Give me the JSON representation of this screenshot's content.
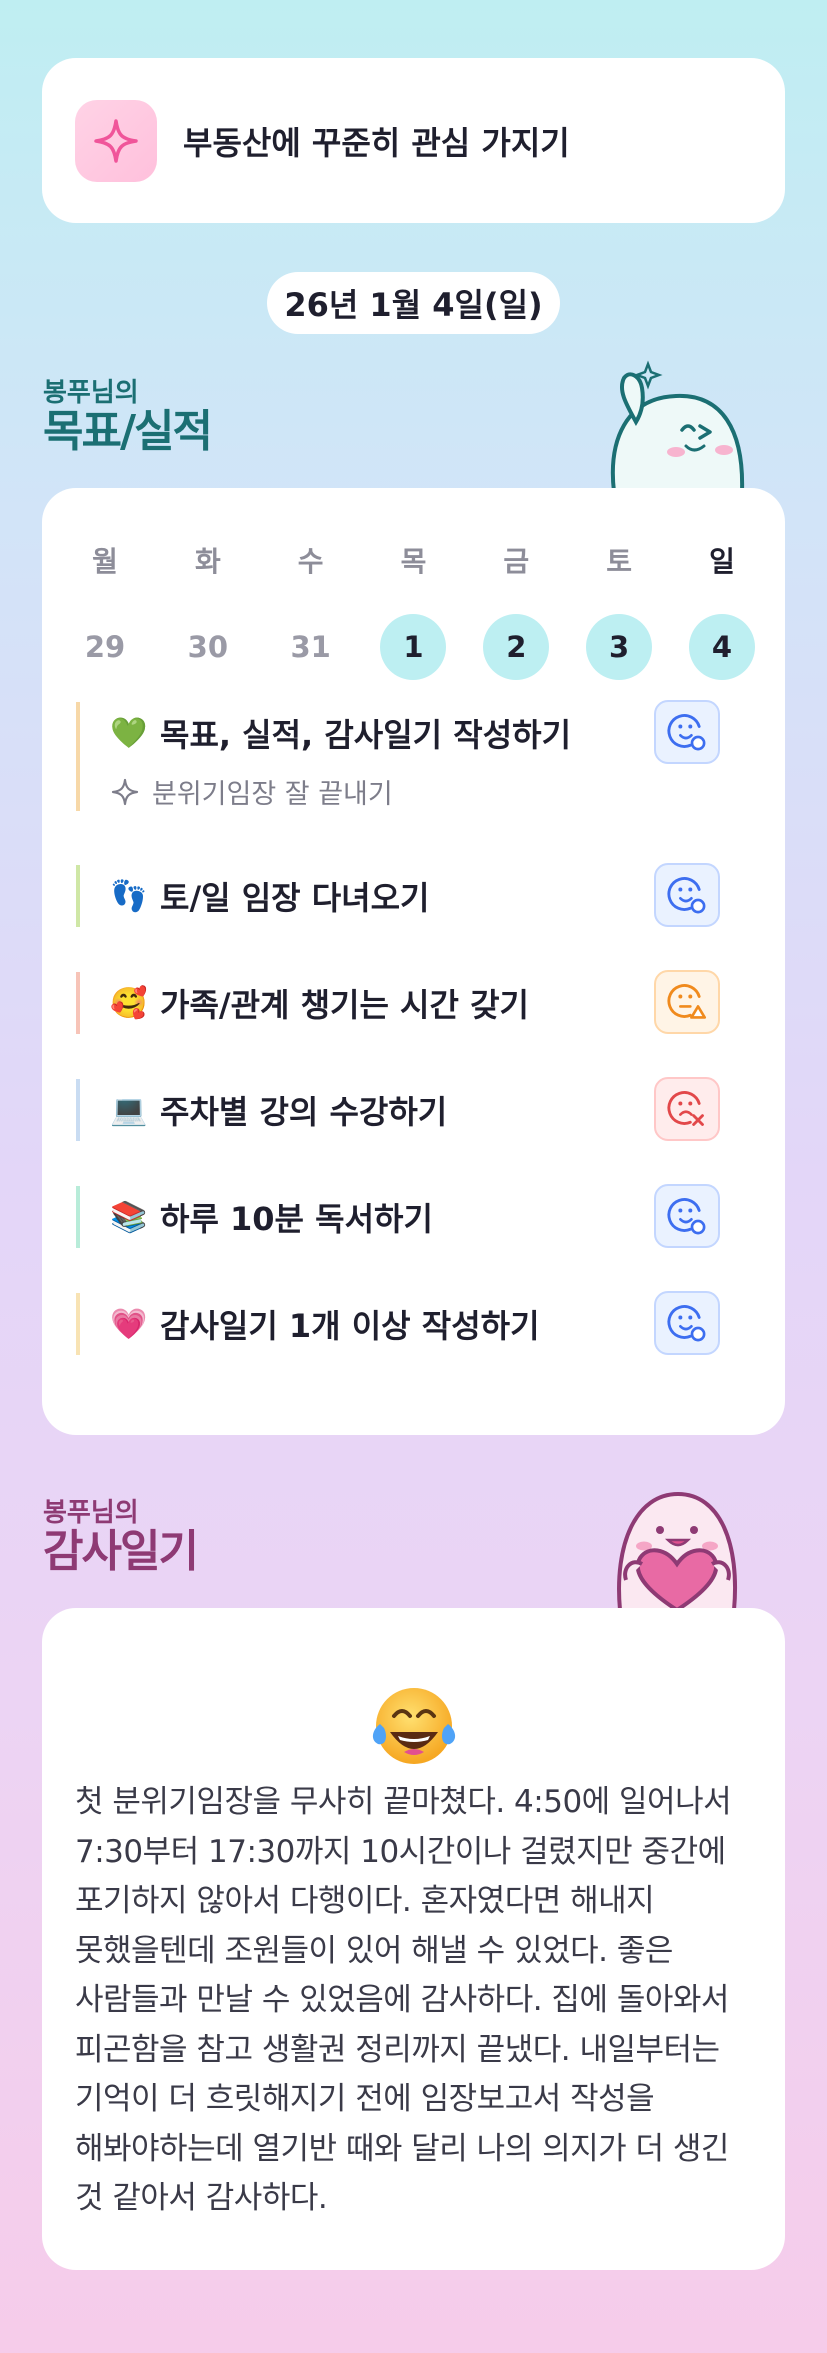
{
  "goal_banner": {
    "text": "부동산에 꾸준히 관심 가지기",
    "icon": "sparkle-icon"
  },
  "date": "26년 1월 4일(일)",
  "goals_section": {
    "owner": "봉푸님의",
    "title": "목표/실적"
  },
  "week": {
    "days": [
      {
        "dow": "월",
        "date": "29",
        "highlighted": false
      },
      {
        "dow": "화",
        "date": "30",
        "highlighted": false
      },
      {
        "dow": "수",
        "date": "31",
        "highlighted": false
      },
      {
        "dow": "목",
        "date": "1",
        "highlighted": true
      },
      {
        "dow": "금",
        "date": "2",
        "highlighted": true
      },
      {
        "dow": "토",
        "date": "3",
        "highlighted": true
      },
      {
        "dow": "일",
        "date": "4",
        "highlighted": true
      }
    ]
  },
  "tasks": [
    {
      "emoji": "💚",
      "label": "목표, 실적, 감사일기 작성하기",
      "sub": "분위기임장 잘 끝내기",
      "status": "done",
      "color": "#f7d8a8"
    },
    {
      "emoji": "👣",
      "label": "토/일 임장 다녀오기",
      "status": "done",
      "color": "#cfe7a6"
    },
    {
      "emoji": "🥰",
      "label": "가족/관계 챙기는 시간 갖기",
      "status": "partial",
      "color": "#f7c4b8"
    },
    {
      "emoji": "💻",
      "label": "주차별 강의 수강하기",
      "status": "failed",
      "color": "#c9dcf2"
    },
    {
      "emoji": "📚",
      "label": "하루 10분 독서하기",
      "status": "done",
      "color": "#b8ecd9"
    },
    {
      "emoji": "💗",
      "label": "감사일기 1개 이상 작성하기",
      "status": "done",
      "color": "#f8e3b4"
    }
  ],
  "gratitude_section": {
    "owner": "봉푸님의",
    "title": "감사일기"
  },
  "gratitude": {
    "emoji": "face-with-tears-of-joy-icon",
    "text": "첫 분위기임장을 무사히 끝마쳤다. 4:50에 일어나서 7:30부터 17:30까지 10시간이나 걸렸지만 중간에 포기하지 않아서 다행이다. 혼자였다면 해내지 못했을텐데 조원들이 있어 해낼 수 있었다. 좋은 사람들과 만날 수 있었음에 감사하다. 집에 돌아와서 피곤함을 참고 생활권 정리까지 끝냈다. 내일부터는 기억이 더 흐릿해지기 전에 임장보고서 작성을 해봐야하는데 열기반 때와 달리 나의 의지가 더 생긴 것 같아서 감사하다."
  },
  "colors": {
    "teal": "#1b6f73",
    "plum": "#8e3a74",
    "highlight": "#bdeff2"
  }
}
